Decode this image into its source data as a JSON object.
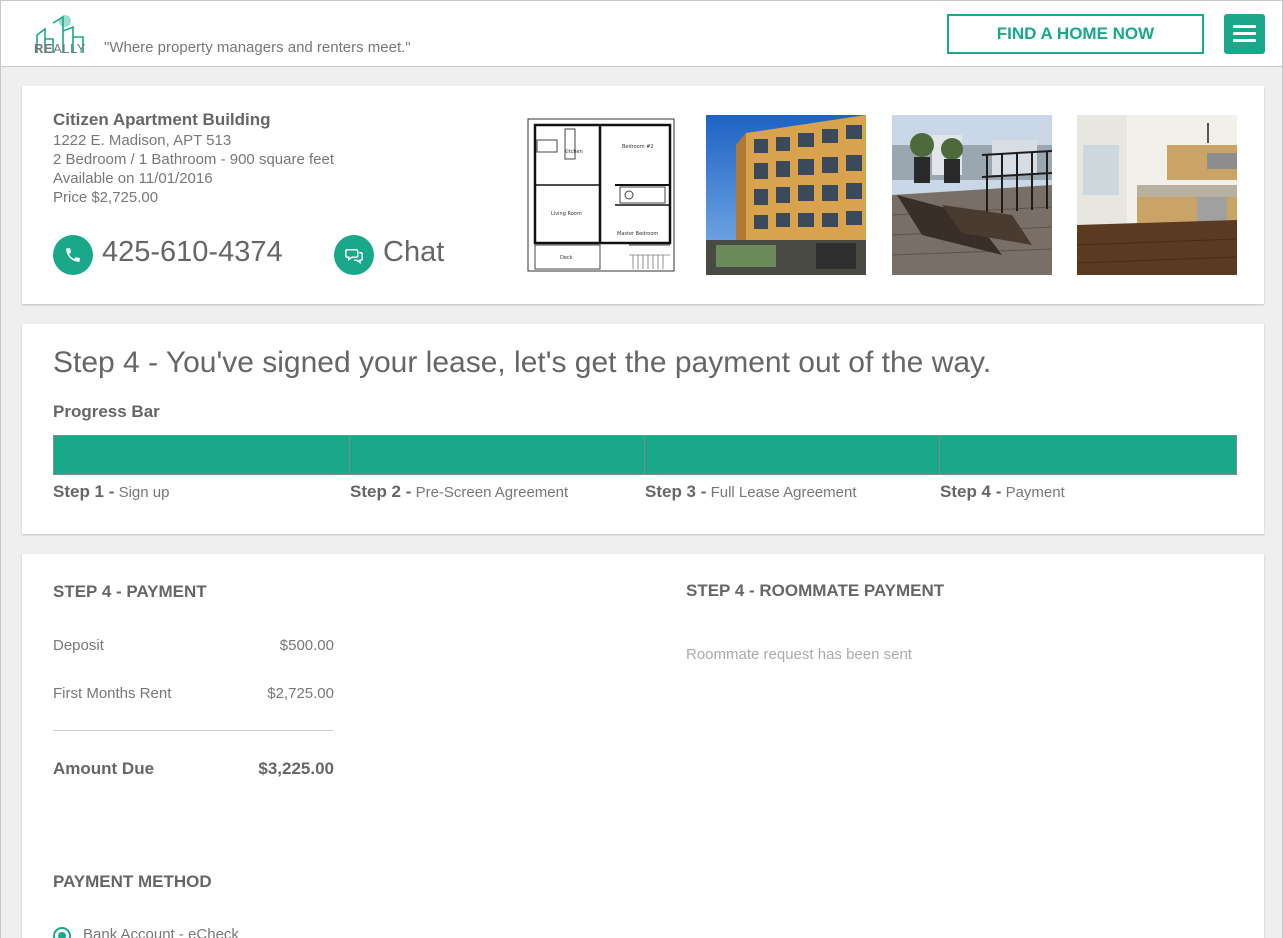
{
  "header": {
    "logo_bold": "RE",
    "logo_thin": "ALLY",
    "tagline": "\"Where property managers and renters meet.\"",
    "find_button": "FIND A HOME NOW",
    "menu_icon": "hamburger-icon",
    "accent": "#1aa88a"
  },
  "listing": {
    "name": "Citizen Apartment Building",
    "address": "1222 E. Madison, APT 513",
    "details": "2 Bedroom / 1 Bathroom - 900 square feet",
    "available": "Available on 11/01/2016",
    "price": "Price $2,725.00",
    "phone": "425-610-4374",
    "chat": "Chat",
    "floorplan_labels": {
      "kitchen": "Kitchen",
      "bedroom2": "Bedroom #2",
      "living": "Living Room",
      "master": "Master Bedroom",
      "deck": "Deck"
    }
  },
  "progress": {
    "title": "Step 4 - You've signed your lease, let's get the payment out of the way.",
    "label": "Progress Bar",
    "fraction": 1.0,
    "steps": [
      {
        "num": "Step 1 -",
        "name": "Sign up"
      },
      {
        "num": "Step 2 -",
        "name": "Pre-Screen Agreement"
      },
      {
        "num": "Step 3 -",
        "name": "Full Lease Agreement"
      },
      {
        "num": "Step 4 -",
        "name": "Payment"
      }
    ]
  },
  "payment": {
    "heading": "STEP 4 - PAYMENT",
    "rows": [
      {
        "label": "Deposit",
        "value": "$500.00"
      },
      {
        "label": "First Months Rent",
        "value": "$2,725.00"
      }
    ],
    "due_label": "Amount Due",
    "due_value": "$3,225.00",
    "method_heading": "PAYMENT METHOD",
    "method_option": "Bank Account - eCheck"
  },
  "roommate": {
    "heading": "STEP 4 - ROOMMATE PAYMENT",
    "status": "Roommate request has been sent"
  }
}
